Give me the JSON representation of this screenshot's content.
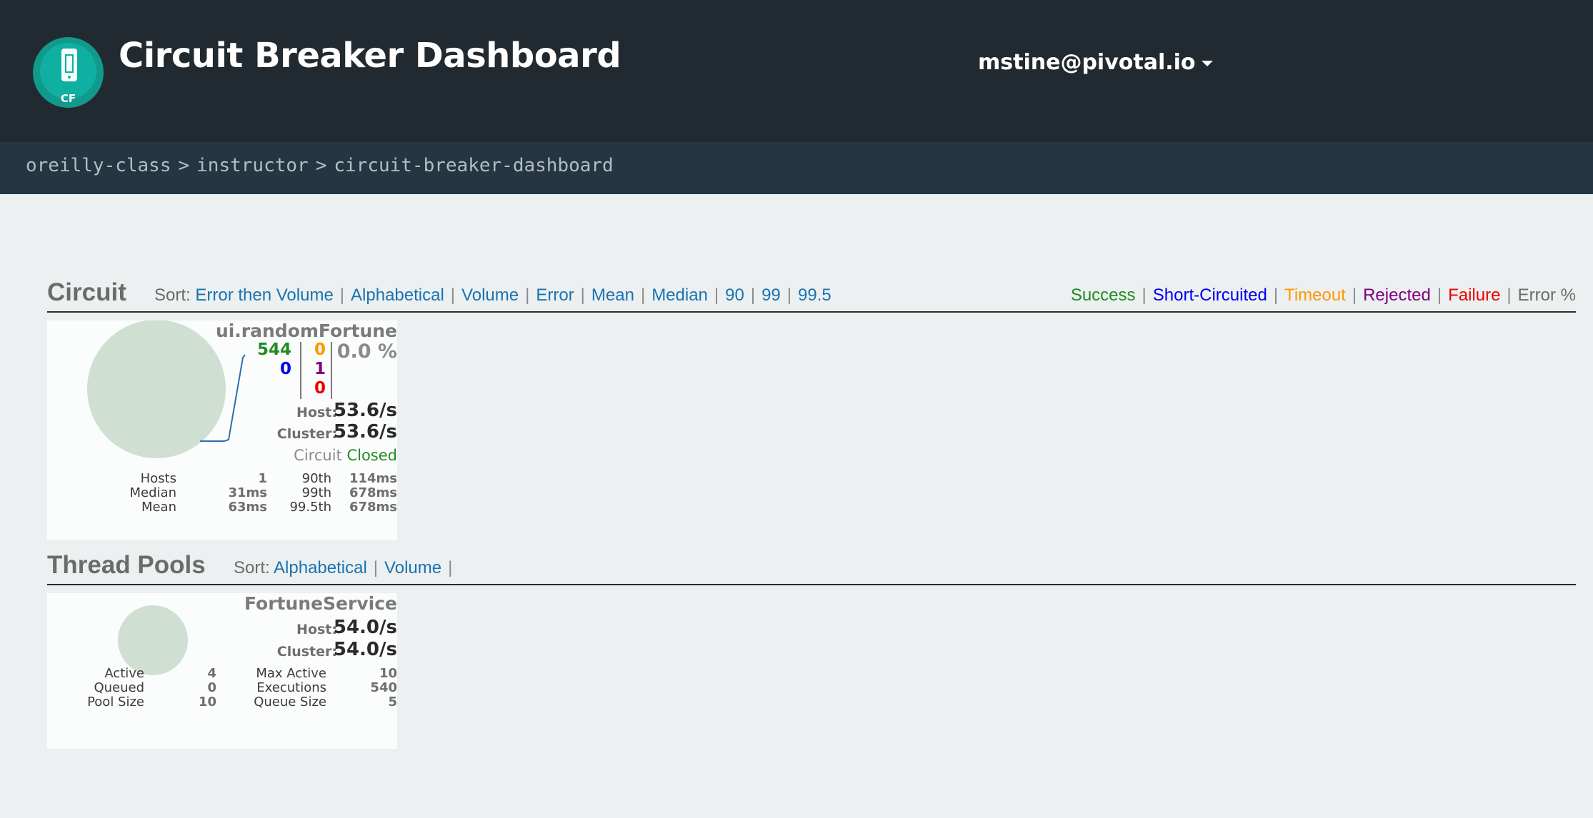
{
  "header": {
    "logo_text": "CF",
    "title": "Circuit Breaker Dashboard",
    "user": "mstine@pivotal.io"
  },
  "breadcrumb": [
    "oreilly-class",
    "instructor",
    "circuit-breaker-dashboard"
  ],
  "circuit_section": {
    "title": "Circuit",
    "sort_label": "Sort:",
    "sort_options": [
      "Error then Volume",
      "Alphabetical",
      "Volume",
      "Error",
      "Mean",
      "Median",
      "90",
      "99",
      "99.5"
    ],
    "legend": [
      {
        "label": "Success",
        "color": "#228b22"
      },
      {
        "label": "Short-Circuited",
        "color": "#0000ee"
      },
      {
        "label": "Timeout",
        "color": "#ff9900"
      },
      {
        "label": "Rejected",
        "color": "#800080"
      },
      {
        "label": "Failure",
        "color": "#ee0000"
      },
      {
        "label": "Error %",
        "color": "#6b6b6b"
      }
    ]
  },
  "circuit": {
    "name": "ui.randomFortune",
    "success": "544",
    "short_circuited": "0",
    "timeout": "0",
    "rejected": "1",
    "failure": "0",
    "error_pct": "0.0 %",
    "host_label": "Host:",
    "host_rate": "53.6/s",
    "cluster_label": "Cluster:",
    "cluster_rate": "53.6/s",
    "status_label": "Circuit",
    "status_value": "Closed",
    "stats": {
      "hosts_label": "Hosts",
      "hosts": "1",
      "median_label": "Median",
      "median": "31ms",
      "mean_label": "Mean",
      "mean": "63ms",
      "p90_label": "90th",
      "p90": "114ms",
      "p99_label": "99th",
      "p99": "678ms",
      "p995_label": "99.5th",
      "p995": "678ms"
    },
    "circle_color": "#cfdfd1",
    "sparkline_color": "#2e6fad"
  },
  "threadpool_section": {
    "title": "Thread Pools",
    "sort_label": "Sort:",
    "sort_options": [
      "Alphabetical",
      "Volume"
    ]
  },
  "threadpool": {
    "name": "FortuneService",
    "host_label": "Host:",
    "host_rate": "54.0/s",
    "cluster_label": "Cluster:",
    "cluster_rate": "54.0/s",
    "stats": {
      "active_label": "Active",
      "active": "4",
      "queued_label": "Queued",
      "queued": "0",
      "pool_size_label": "Pool Size",
      "pool_size": "10",
      "max_active_label": "Max Active",
      "max_active": "10",
      "executions_label": "Executions",
      "executions": "540",
      "queue_size_label": "Queue Size",
      "queue_size": "5"
    },
    "circle_color": "#cfdfd1"
  }
}
